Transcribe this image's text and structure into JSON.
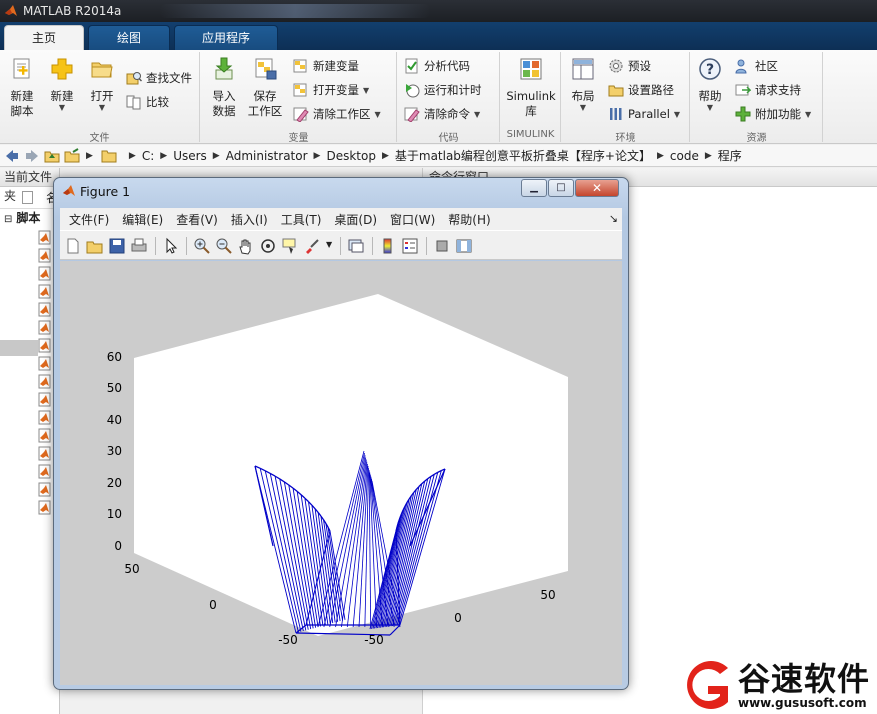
{
  "app": {
    "title": "MATLAB R2014a"
  },
  "tabs": [
    {
      "label": "主页",
      "active": true
    },
    {
      "label": "绘图",
      "active": false
    },
    {
      "label": "应用程序",
      "active": false
    }
  ],
  "ribbon": {
    "file": {
      "caption": "文件",
      "new_script": "新建\n脚本",
      "new": "新建",
      "open": "打开",
      "find_files": "查找文件",
      "compare": "比较"
    },
    "variable": {
      "caption": "变量",
      "import_data": "导入\n数据",
      "save_workspace": "保存\n工作区",
      "new_variable": "新建变量",
      "open_variable": "打开变量",
      "clear_workspace": "清除工作区"
    },
    "code": {
      "caption": "代码",
      "analyze_code": "分析代码",
      "run_and_time": "运行和计时",
      "clear_commands": "清除命令"
    },
    "simulink": {
      "caption": "SIMULINK",
      "library": "Simulink\n库"
    },
    "environment": {
      "caption": "环境",
      "layout": "布局",
      "preferences": "预设",
      "set_path": "设置路径",
      "parallel": "Parallel"
    },
    "resources": {
      "caption": "资源",
      "help": "帮助",
      "community": "社区",
      "request_support": "请求支持",
      "add_ons": "附加功能"
    }
  },
  "address": {
    "crumbs": [
      "C:",
      "Users",
      "Administrator",
      "Desktop",
      "基于matlab编程创意平板折叠桌【程序+论文】",
      "code",
      "程序"
    ]
  },
  "left_panel": {
    "title": "当前文件夹",
    "column_name": "名",
    "tree_label": "脚本",
    "file_count": 16
  },
  "right_panel": {
    "title": "命令行窗口"
  },
  "figure": {
    "title": "Figure 1",
    "menu": [
      "文件(F)",
      "编辑(E)",
      "查看(V)",
      "插入(I)",
      "工具(T)",
      "桌面(D)",
      "窗口(W)",
      "帮助(H)"
    ],
    "line_color": "#0000c8",
    "axes": {
      "z_ticks": [
        "60",
        "50",
        "40",
        "30",
        "20",
        "10",
        "0"
      ],
      "x_ticks": [
        "50",
        "0",
        "-50"
      ],
      "y_ticks": [
        "-50",
        "0",
        "50"
      ]
    }
  },
  "watermark": {
    "brand": "谷速软件",
    "url": "www.gususoft.com"
  }
}
